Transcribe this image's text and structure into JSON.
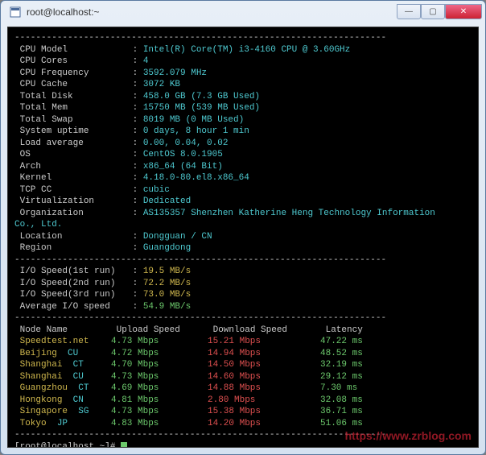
{
  "window": {
    "title": "root@localhost:~"
  },
  "sysinfo": [
    {
      "label": "CPU Model",
      "value": "Intel(R) Core(TM) i3-4160 CPU @ 3.60GHz"
    },
    {
      "label": "CPU Cores",
      "value": "4"
    },
    {
      "label": "CPU Frequency",
      "value": "3592.079 MHz"
    },
    {
      "label": "CPU Cache",
      "value": "3072 KB"
    },
    {
      "label": "Total Disk",
      "value": "458.0 GB (7.3 GB Used)"
    },
    {
      "label": "Total Mem",
      "value": "15750 MB (539 MB Used)"
    },
    {
      "label": "Total Swap",
      "value": "8019 MB (0 MB Used)"
    },
    {
      "label": "System uptime",
      "value": "0 days, 8 hour 1 min"
    },
    {
      "label": "Load average",
      "value": "0.00, 0.04, 0.02"
    },
    {
      "label": "OS",
      "value": "CentOS 8.0.1905"
    },
    {
      "label": "Arch",
      "value": "x86_64 (64 Bit)"
    },
    {
      "label": "Kernel",
      "value": "4.18.0-80.el8.x86_64"
    },
    {
      "label": "TCP CC",
      "value": "cubic"
    },
    {
      "label": "Virtualization",
      "value": "Dedicated"
    },
    {
      "label": "Organization",
      "value": "AS135357 Shenzhen Katherine Heng Technology Information"
    }
  ],
  "org_suffix": "Co., Ltd.",
  "location_rows": [
    {
      "label": "Location",
      "value": "Dongguan / CN"
    },
    {
      "label": "Region",
      "value": "Guangdong"
    }
  ],
  "io": [
    {
      "label": "I/O Speed(1st run)",
      "value": "19.5 MB/s",
      "cls": "val-yellow"
    },
    {
      "label": "I/O Speed(2nd run)",
      "value": "72.2 MB/s",
      "cls": "val-yellow"
    },
    {
      "label": "I/O Speed(3rd run)",
      "value": "73.0 MB/s",
      "cls": "val-yellow"
    },
    {
      "label": "Average I/O speed",
      "value": "54.9 MB/s",
      "cls": "val-green"
    }
  ],
  "speed_header": [
    "Node Name",
    "Upload Speed",
    "Download Speed",
    "Latency"
  ],
  "speedtests": [
    {
      "name": "Speedtest.net",
      "up": "4.73 Mbps",
      "dl": "15.21 Mbps",
      "lat": "47.22 ms"
    },
    {
      "name": "Beijing    CU",
      "up": "4.72 Mbps",
      "dl": "14.94 Mbps",
      "lat": "48.52 ms"
    },
    {
      "name": "Shanghai   CT",
      "up": "4.70 Mbps",
      "dl": "14.50 Mbps",
      "lat": "32.19 ms"
    },
    {
      "name": "Shanghai   CU",
      "up": "4.73 Mbps",
      "dl": "14.60 Mbps",
      "lat": "29.12 ms"
    },
    {
      "name": "Guangzhou  CT",
      "up": "4.69 Mbps",
      "dl": "14.88 Mbps",
      "lat": "7.30 ms"
    },
    {
      "name": "Hongkong   CN",
      "up": "4.81 Mbps",
      "dl": "2.80 Mbps",
      "lat": "32.08 ms"
    },
    {
      "name": "Singapore  SG",
      "up": "4.73 Mbps",
      "dl": "15.38 Mbps",
      "lat": "36.71 ms"
    },
    {
      "name": "Tokyo      JP",
      "up": "4.83 Mbps",
      "dl": "14.20 Mbps",
      "lat": "51.06 ms"
    }
  ],
  "prompt": "[root@localhost ~]#",
  "watermark": "https://www.zrblog.com",
  "dashes": "----------------------------------------------------------------------"
}
